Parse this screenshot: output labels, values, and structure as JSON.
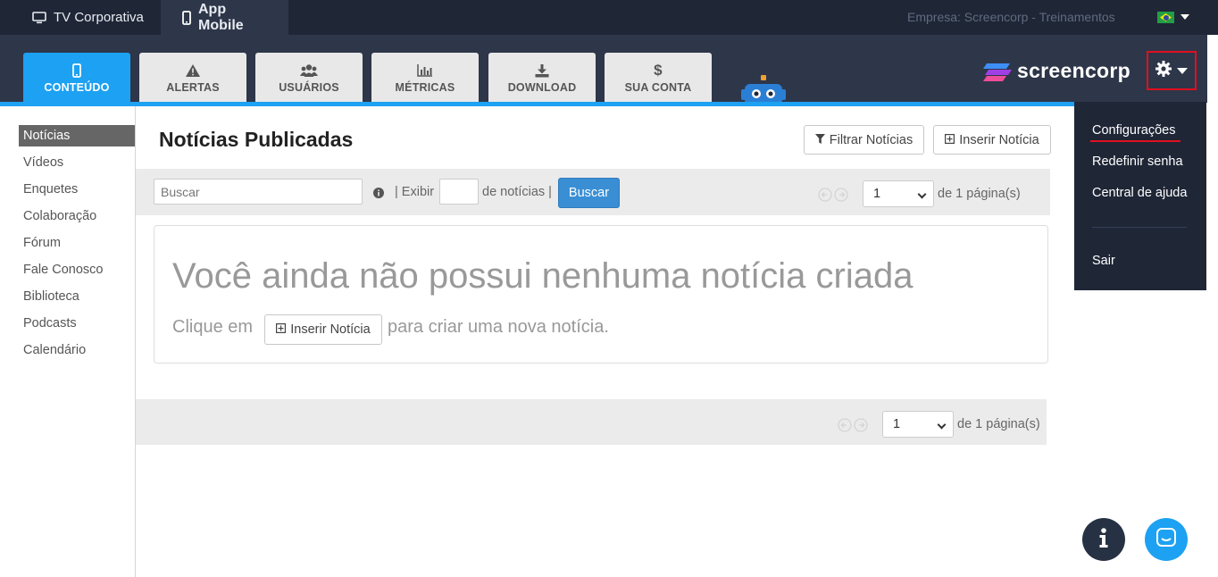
{
  "topbar": {
    "tv_label": "TV Corporativa",
    "app_label": "App Mobile",
    "empresa": "Empresa: Screencorp - Treinamentos"
  },
  "tabs": [
    {
      "label": "CONTEÚDO",
      "icon": "mobile-icon",
      "active": true
    },
    {
      "label": "ALERTAS",
      "icon": "warning-icon",
      "active": false
    },
    {
      "label": "USUÁRIOS",
      "icon": "users-icon",
      "active": false
    },
    {
      "label": "MÉTRICAS",
      "icon": "bar-chart-icon",
      "active": false
    },
    {
      "label": "DOWNLOAD",
      "icon": "download-icon",
      "active": false
    },
    {
      "label": "SUA CONTA",
      "icon": "dollar-icon",
      "active": false
    }
  ],
  "logo": {
    "text": "screencorp"
  },
  "settings_menu": {
    "items": [
      "Configurações",
      "Redefinir senha",
      "Central de ajuda"
    ],
    "logout": "Sair"
  },
  "sidebar": {
    "items": [
      "Notícias",
      "Vídeos",
      "Enquetes",
      "Colaboração",
      "Fórum",
      "Fale Conosco",
      "Biblioteca",
      "Podcasts",
      "Calendário"
    ],
    "active": "Notícias"
  },
  "main": {
    "title": "Notícias Publicadas",
    "filter_button": "Filtrar Notícias",
    "insert_button": "Inserir Notícia",
    "search_placeholder": "Buscar",
    "exibir_label": "| Exibir",
    "de_noticias_label": "de notícias |",
    "search_button": "Buscar",
    "page_value": "1",
    "page_suffix": "de 1 página(s)",
    "empty_heading": "Você ainda não possui nenhuma notícia criada",
    "empty_prefix": "Clique em",
    "empty_button": "Inserir Notícia",
    "empty_suffix": "para criar uma nova notícia."
  },
  "colors": {
    "accent": "#1da1f2",
    "dark_bg": "#1f2636",
    "nav_bg": "#2e3649",
    "highlight": "#e0101f",
    "search_btn": "#3a8fd4"
  }
}
